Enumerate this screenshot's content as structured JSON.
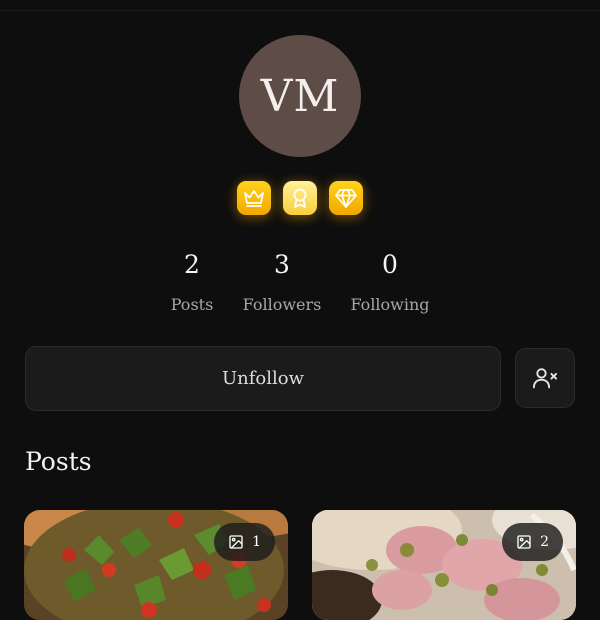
{
  "profile": {
    "initials": "VM",
    "badges": [
      "crown-icon",
      "award-icon",
      "gem-icon"
    ]
  },
  "stats": [
    {
      "value": "2",
      "label": "Posts"
    },
    {
      "value": "3",
      "label": "Followers"
    },
    {
      "value": "0",
      "label": "Following"
    }
  ],
  "actions": {
    "unfollow_label": "Unfollow",
    "remove_icon": "user-x-icon"
  },
  "posts_section": {
    "title": "Posts",
    "items": [
      {
        "image_icon": "image-icon",
        "count": "1"
      },
      {
        "image_icon": "image-icon",
        "count": "2"
      }
    ]
  },
  "colors": {
    "background": "#0f0e0e",
    "avatar": "#5e4c46",
    "badge_gold": "#ffc107",
    "button": "#1c1b1b"
  }
}
